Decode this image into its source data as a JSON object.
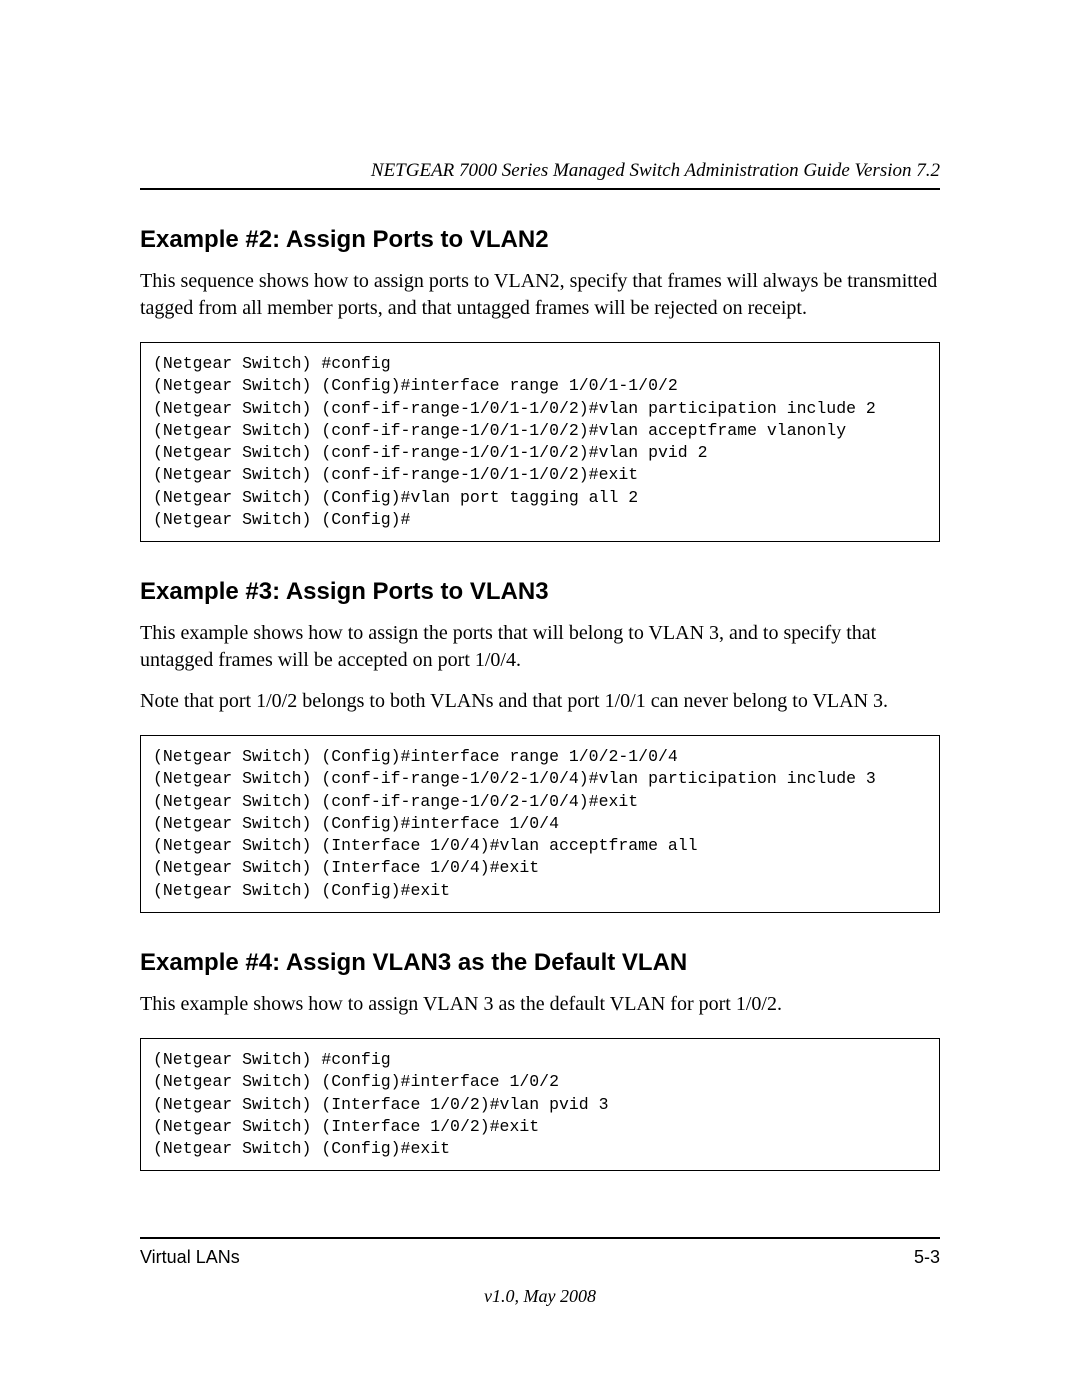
{
  "header": {
    "title": "NETGEAR 7000 Series Managed Switch Administration Guide Version 7.2"
  },
  "sections": {
    "ex2": {
      "heading": "Example #2: Assign Ports to VLAN2",
      "p1": "This sequence shows how to assign ports to VLAN2, specify that frames will always be transmitted tagged from all member ports, and that untagged frames will be rejected on receipt.",
      "code": "(Netgear Switch) #config\n(Netgear Switch) (Config)#interface range 1/0/1-1/0/2\n(Netgear Switch) (conf-if-range-1/0/1-1/0/2)#vlan participation include 2\n(Netgear Switch) (conf-if-range-1/0/1-1/0/2)#vlan acceptframe vlanonly\n(Netgear Switch) (conf-if-range-1/0/1-1/0/2)#vlan pvid 2\n(Netgear Switch) (conf-if-range-1/0/1-1/0/2)#exit\n(Netgear Switch) (Config)#vlan port tagging all 2\n(Netgear Switch) (Config)#"
    },
    "ex3": {
      "heading": "Example #3: Assign Ports to VLAN3",
      "p1": "This example shows how to assign the ports that will belong to VLAN 3, and to specify that untagged frames will be accepted on port 1/0/4.",
      "p2": "Note that port 1/0/2 belongs to both VLANs and that port 1/0/1 can never belong to VLAN 3.",
      "code": "(Netgear Switch) (Config)#interface range 1/0/2-1/0/4\n(Netgear Switch) (conf-if-range-1/0/2-1/0/4)#vlan participation include 3\n(Netgear Switch) (conf-if-range-1/0/2-1/0/4)#exit\n(Netgear Switch) (Config)#interface 1/0/4\n(Netgear Switch) (Interface 1/0/4)#vlan acceptframe all\n(Netgear Switch) (Interface 1/0/4)#exit\n(Netgear Switch) (Config)#exit"
    },
    "ex4": {
      "heading": "Example #4: Assign VLAN3 as the Default VLAN",
      "p1": "This example shows how to assign VLAN 3 as the default VLAN for port 1/0/2.",
      "code": "(Netgear Switch) #config\n(Netgear Switch) (Config)#interface 1/0/2\n(Netgear Switch) (Interface 1/0/2)#vlan pvid 3\n(Netgear Switch) (Interface 1/0/2)#exit\n(Netgear Switch) (Config)#exit"
    }
  },
  "footer": {
    "chapter": "Virtual LANs",
    "page": "5-3",
    "version": "v1.0, May 2008"
  }
}
